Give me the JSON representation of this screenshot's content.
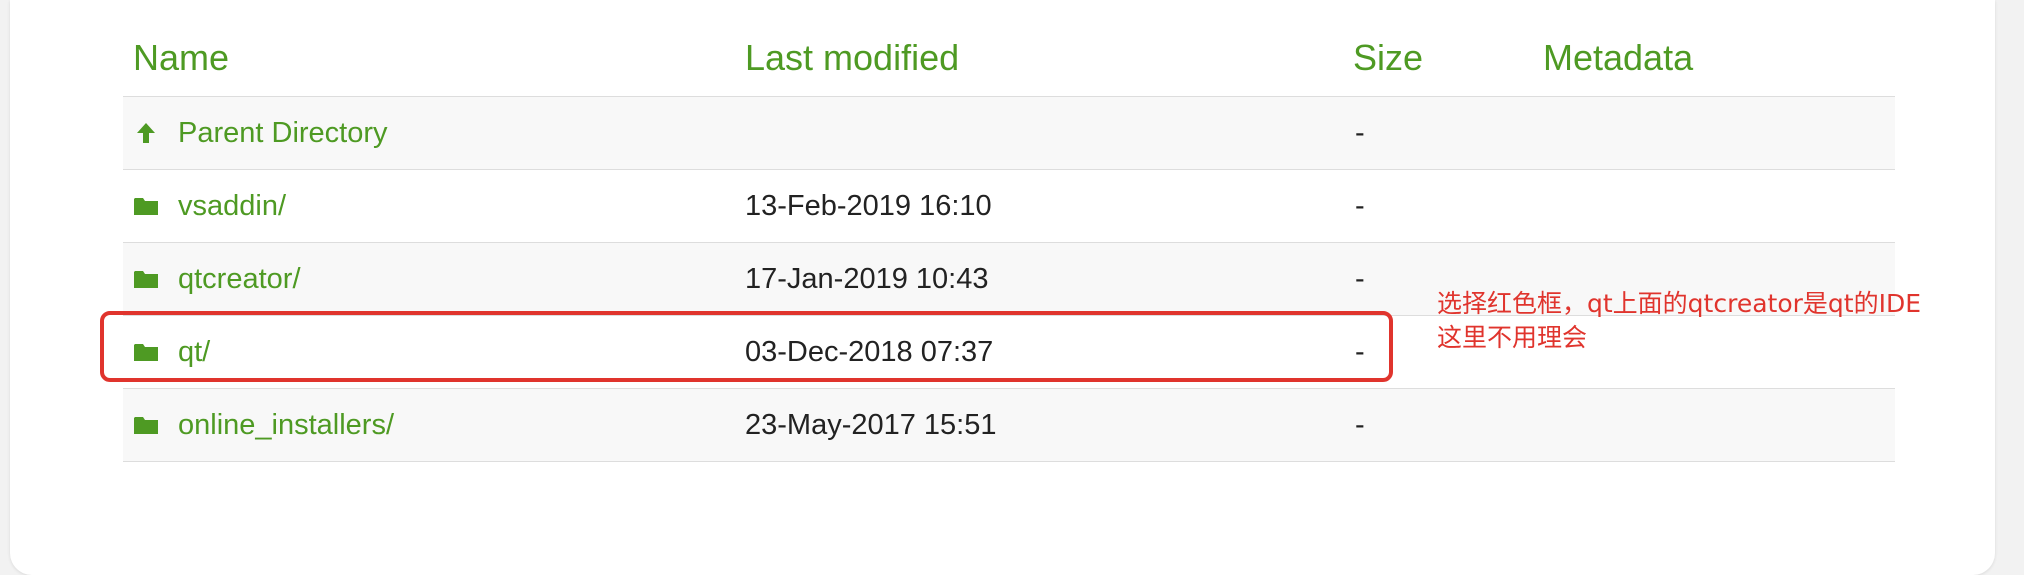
{
  "columns": {
    "name": "Name",
    "last_modified": "Last modified",
    "size": "Size",
    "metadata": "Metadata"
  },
  "rows": [
    {
      "icon": "up-arrow-icon",
      "name": "Parent Directory",
      "modified": "",
      "size": "-"
    },
    {
      "icon": "folder-icon",
      "name": "vsaddin/",
      "modified": "13-Feb-2019 16:10",
      "size": "-"
    },
    {
      "icon": "folder-icon",
      "name": "qtcreator/",
      "modified": "17-Jan-2019 10:43",
      "size": "-"
    },
    {
      "icon": "folder-icon",
      "name": "qt/",
      "modified": "03-Dec-2018 07:37",
      "size": "-"
    },
    {
      "icon": "folder-icon",
      "name": "online_installers/",
      "modified": "23-May-2017 15:51",
      "size": "-"
    }
  ],
  "annotation": {
    "line1": "选择红色框，qt上面的qtcreator是qt的IDE",
    "line2": "这里不用理会"
  },
  "colors": {
    "link_green": "#4e9a23",
    "annotation_red": "#e0342d"
  }
}
